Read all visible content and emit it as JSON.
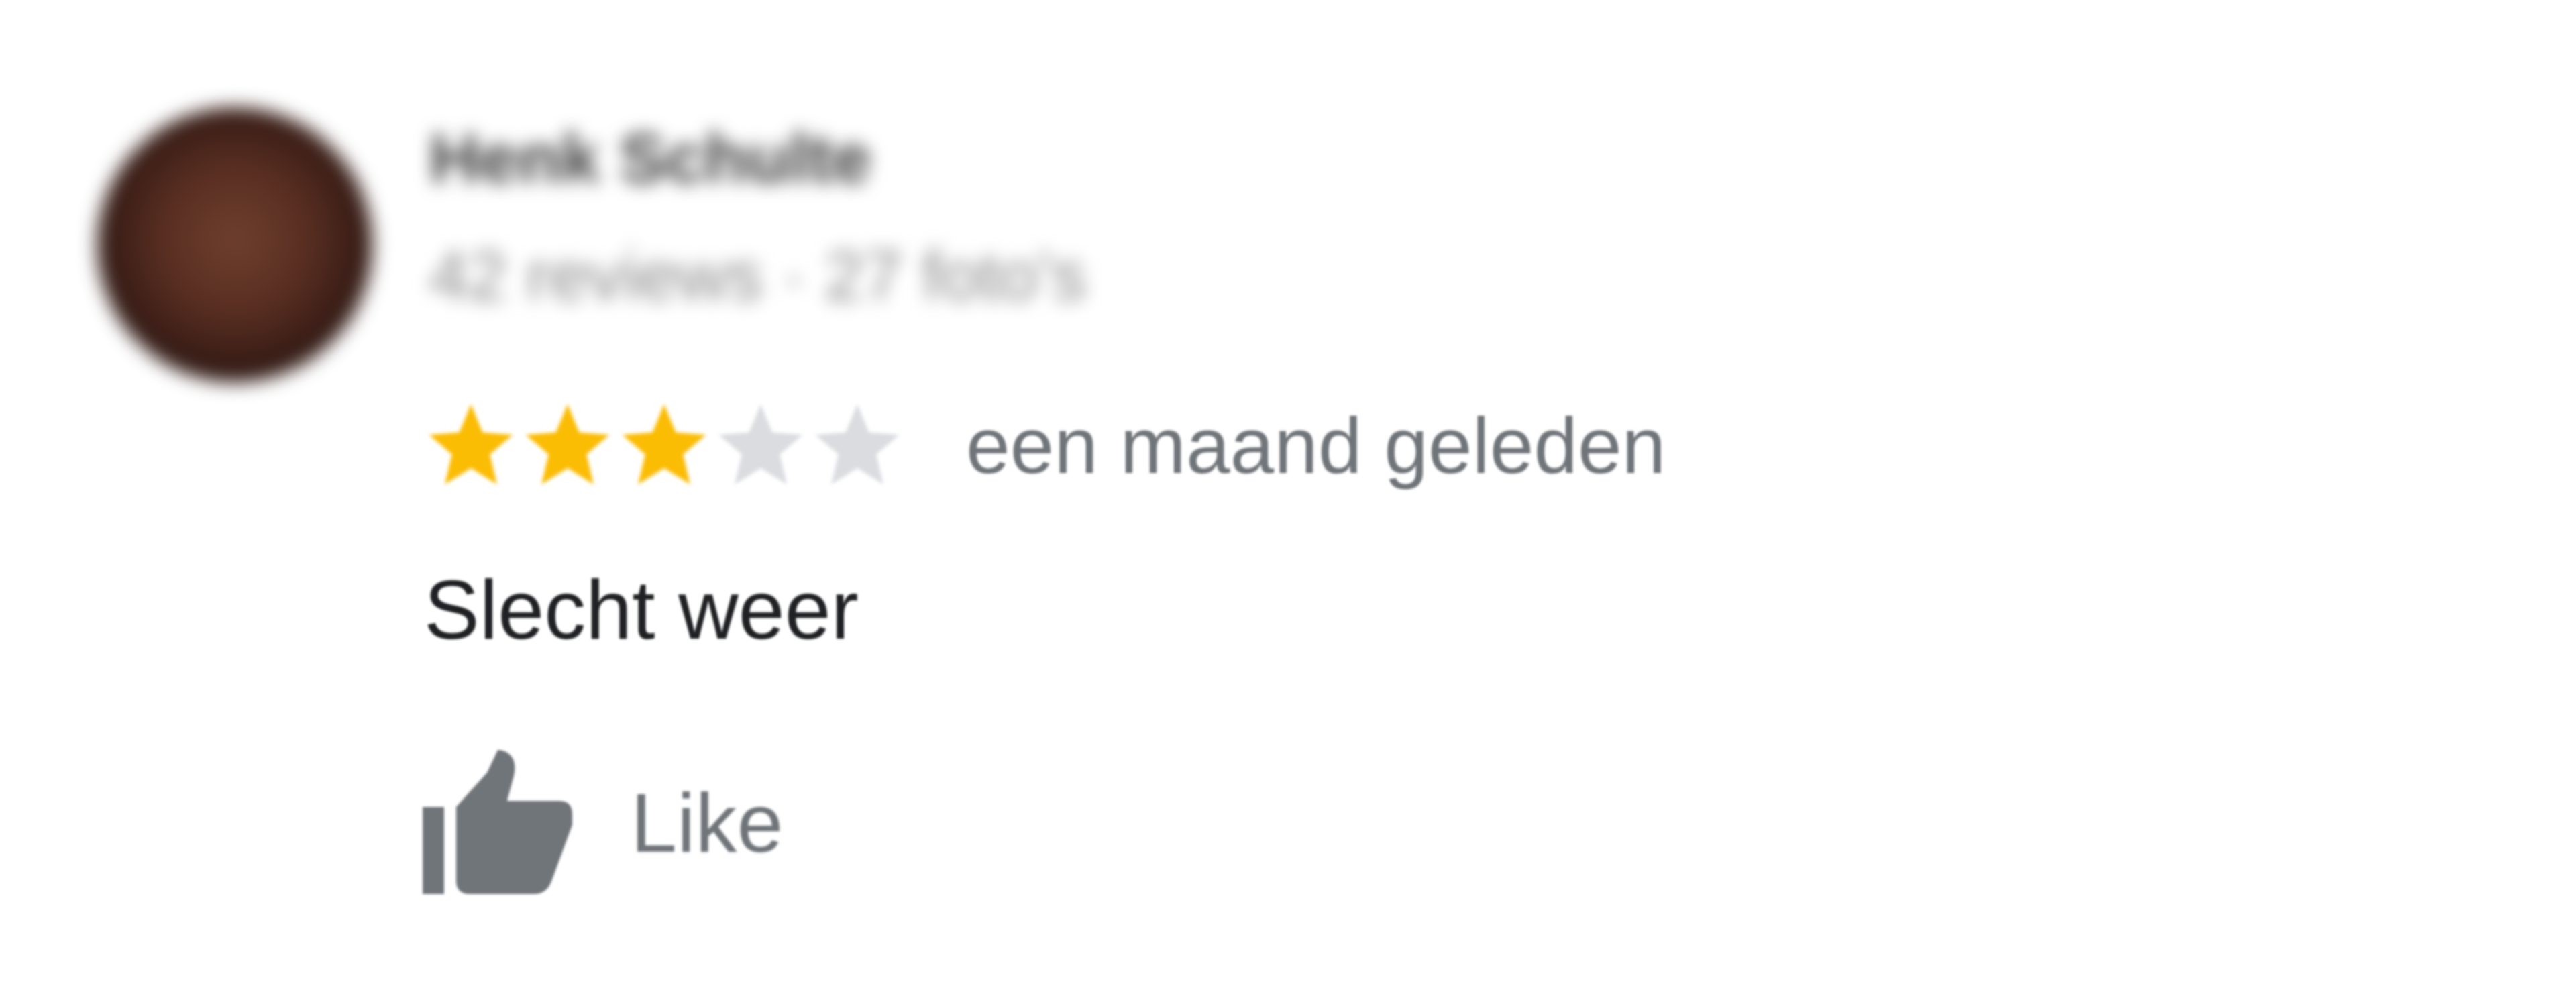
{
  "review": {
    "author": {
      "name": "Henk Schulte",
      "meta": "42 reviews · 27 foto's"
    },
    "rating": {
      "value": 3,
      "max": 5,
      "filled_color": "#fbbc04",
      "empty_color": "#dadce0"
    },
    "timestamp": "een maand geleden",
    "text": "Slecht weer",
    "like": {
      "label": "Like",
      "icon": "thumbs-up-icon",
      "icon_color": "#70757a"
    }
  }
}
